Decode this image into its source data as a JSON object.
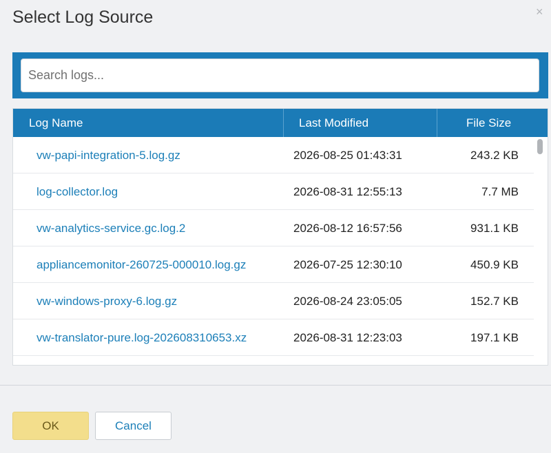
{
  "dialog": {
    "title": "Select Log Source",
    "close_glyph": "×"
  },
  "search": {
    "placeholder": "Search logs...",
    "value": ""
  },
  "table": {
    "columns": [
      "Log Name",
      "Last Modified",
      "File Size"
    ],
    "rows": [
      {
        "name": "vw-papi-integration-5.log.gz",
        "modified": "2026-08-25 01:43:31",
        "size": "243.2 KB"
      },
      {
        "name": "log-collector.log",
        "modified": "2026-08-31 12:55:13",
        "size": "7.7 MB"
      },
      {
        "name": "vw-analytics-service.gc.log.2",
        "modified": "2026-08-12 16:57:56",
        "size": "931.1 KB"
      },
      {
        "name": "appliancemonitor-260725-000010.log.gz",
        "modified": "2026-07-25 12:30:10",
        "size": "450.9 KB"
      },
      {
        "name": "vw-windows-proxy-6.log.gz",
        "modified": "2026-08-24 23:05:05",
        "size": "152.7 KB"
      },
      {
        "name": "vw-translator-pure.log-202608310653.xz",
        "modified": "2026-08-31 12:23:03",
        "size": "197.1 KB"
      }
    ]
  },
  "footer": {
    "ok_label": "OK",
    "cancel_label": "Cancel"
  },
  "colors": {
    "accent": "#1b7bb7",
    "link": "#1c7fb8",
    "ok_button": "#f3de8c",
    "background": "#f0f1f3"
  }
}
